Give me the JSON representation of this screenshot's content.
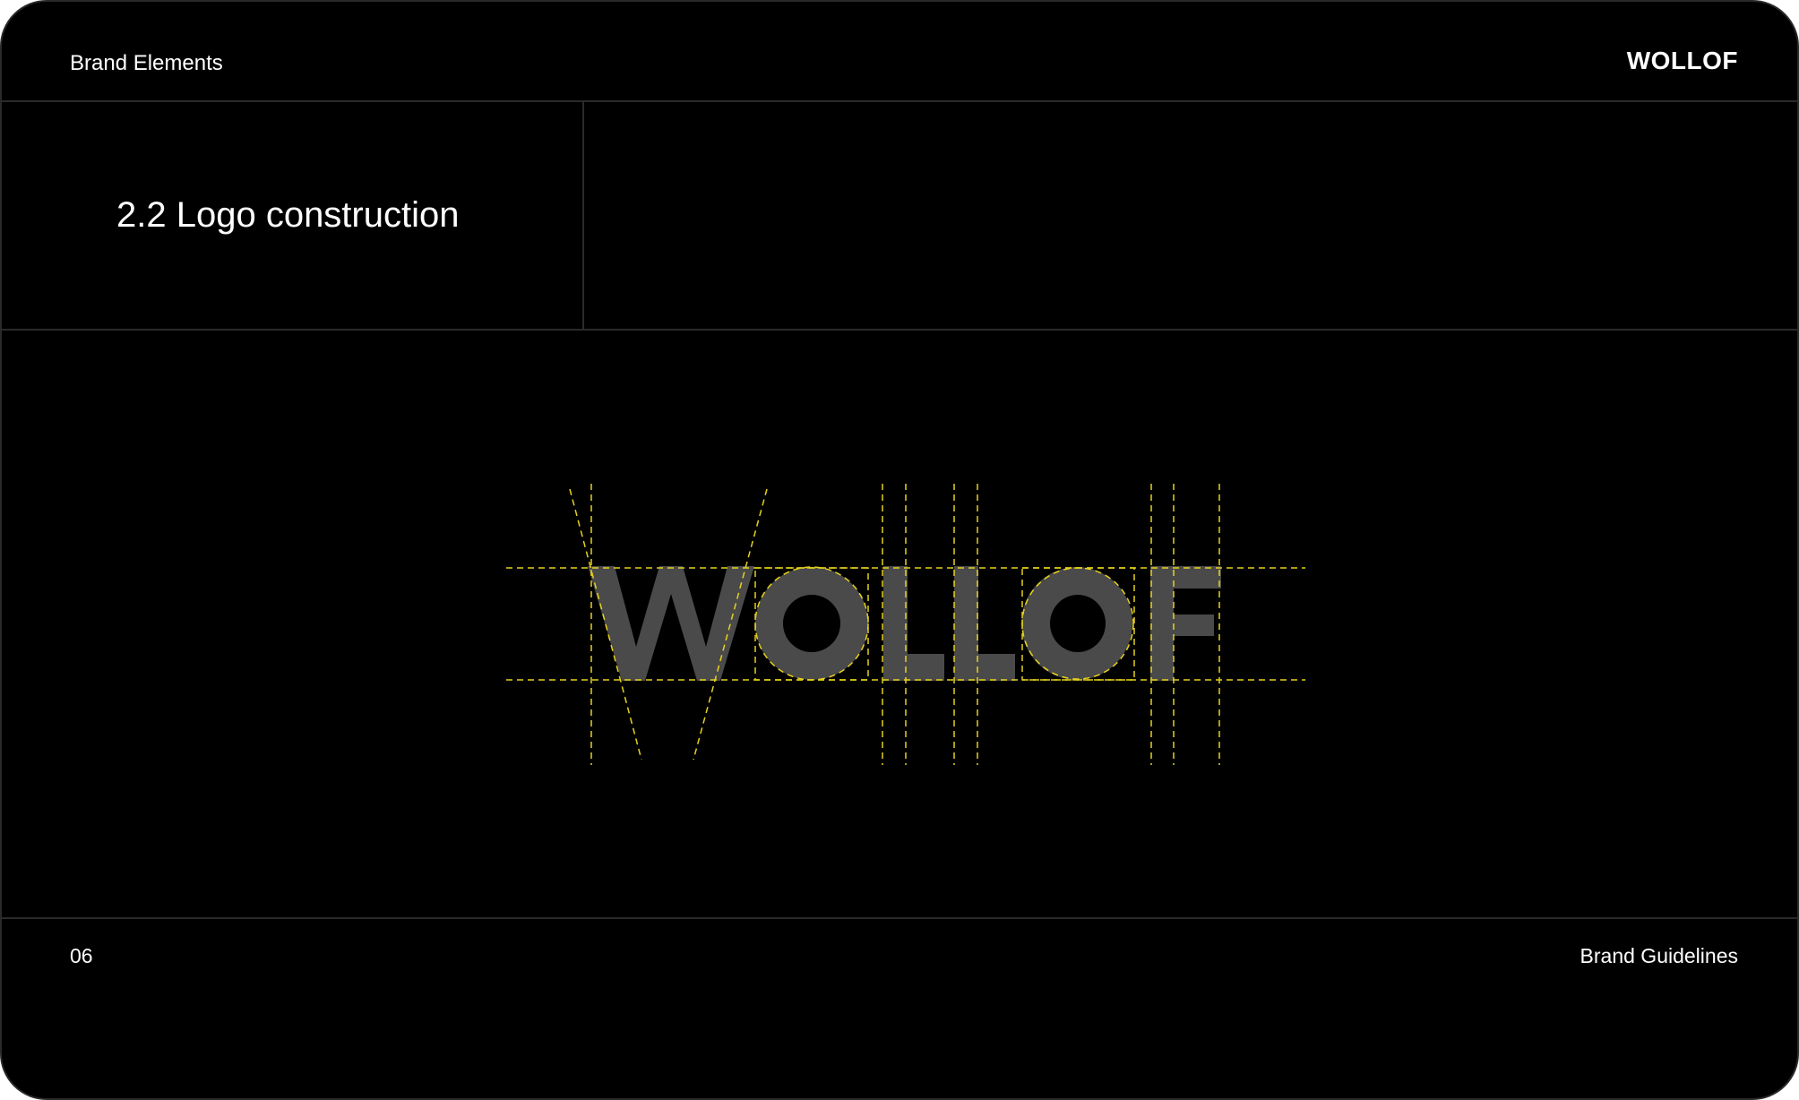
{
  "header": {
    "section": "Brand Elements",
    "brand": "WOLLOF"
  },
  "title": "2.2 Logo construction",
  "logo": {
    "wordmark": "WOLLOF",
    "wordmark_color": "#4a4a4a",
    "guide_color": "#e6d11e"
  },
  "footer": {
    "page_number": "06",
    "document_name": "Brand Guidelines"
  },
  "colors": {
    "background": "#000000",
    "divider": "#2a2a2a",
    "text": "#ffffff"
  }
}
